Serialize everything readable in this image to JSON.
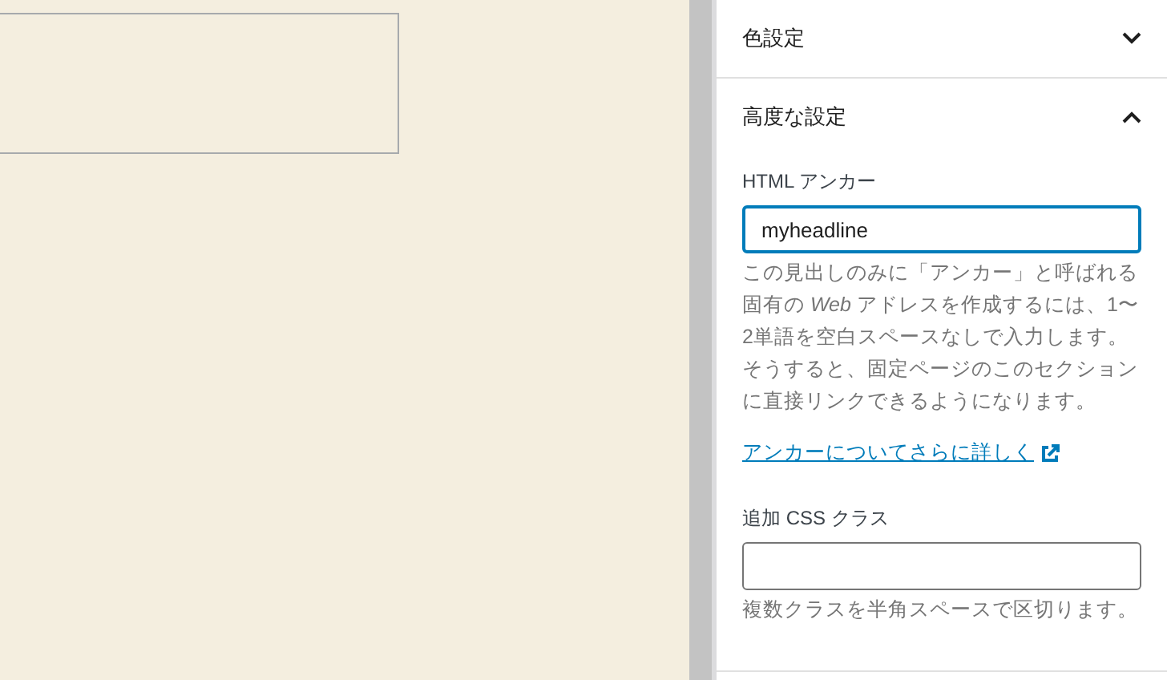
{
  "panels": [
    {
      "title": "色設定",
      "expanded": false
    },
    {
      "title": "高度な設定",
      "expanded": true,
      "fields": [
        {
          "label": "HTML アンカー",
          "value": "myheadline",
          "focused": true,
          "help": "この見出しのみに「アンカー」と呼ばれる固有の *Web* アドレスを作成するには、1〜2単語を空白スペースなしで入力します。そうすると、固定ページのこのセクションに直接リンクできるようになります。",
          "link": "アンカーについてさらに詳しく"
        },
        {
          "label": "追加 CSS クラス",
          "focused": false,
          "help": "複数クラスを半角スペースで区切ります。"
        }
      ]
    }
  ]
}
